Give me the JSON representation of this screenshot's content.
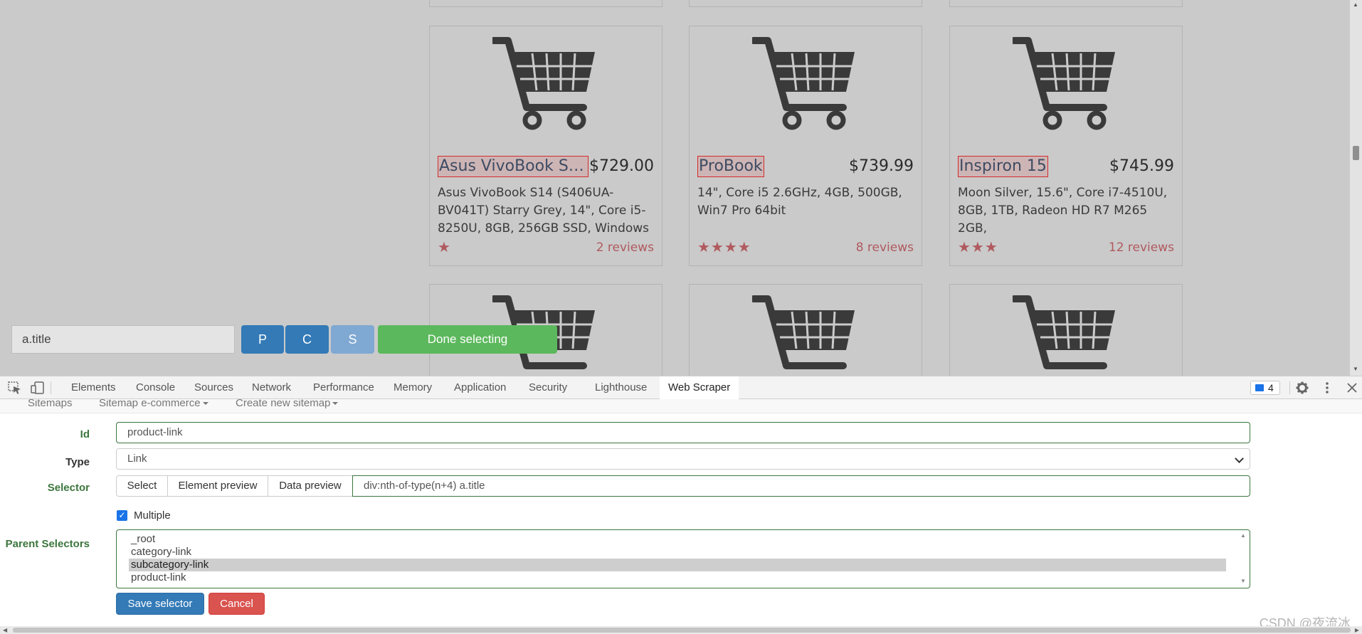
{
  "products": [
    {
      "title": "Asus VivoBook S1...",
      "price": "$729.00",
      "description": "Asus VivoBook S14 (S406UA-BV041T) Starry Grey, 14\", Core i5-8250U, 8GB, 256GB SSD, Windows",
      "stars": "★",
      "reviews": "2 reviews"
    },
    {
      "title": "ProBook",
      "price": "$739.99",
      "description": "14\", Core i5 2.6GHz, 4GB, 500GB, Win7 Pro 64bit",
      "stars": "★★★★",
      "reviews": "8 reviews"
    },
    {
      "title": "Inspiron 15",
      "price": "$745.99",
      "description": "Moon Silver, 15.6\", Core i7-4510U, 8GB, 1TB, Radeon HD R7 M265 2GB,",
      "stars": "★★★",
      "reviews": "12 reviews"
    }
  ],
  "selection_bar": {
    "selector_value": "a.title",
    "parent_button": "P",
    "child_button": "C",
    "select_button": "S",
    "done_button": "Done selecting"
  },
  "devtools": {
    "tabs": [
      "Elements",
      "Console",
      "Sources",
      "Network",
      "Performance",
      "Memory",
      "Application",
      "Security",
      "Lighthouse",
      "Web Scraper"
    ],
    "active_tab": "Web Scraper",
    "issues_count": "4"
  },
  "scraper": {
    "nav": {
      "sitemaps": "Sitemaps",
      "sitemap_menu": "Sitemap e-commerce",
      "create_menu": "Create new sitemap"
    },
    "form": {
      "id_label": "Id",
      "id_value": "product-link",
      "type_label": "Type",
      "type_value": "Link",
      "selector_label": "Selector",
      "select_button": "Select",
      "element_preview_button": "Element preview",
      "data_preview_button": "Data preview",
      "selector_value": "div:nth-of-type(n+4) a.title",
      "multiple_label": "Multiple",
      "multiple_checked": true,
      "parent_selectors_label": "Parent Selectors",
      "parent_selectors": [
        "_root",
        "category-link",
        "subcategory-link",
        "product-link"
      ],
      "parent_selected": "subcategory-link",
      "save_button": "Save selector",
      "cancel_button": "Cancel"
    }
  },
  "watermark": "CSDN @夜流冰",
  "colors": {
    "primary": "#337ab7",
    "success": "#5cb85c",
    "danger": "#d9534f",
    "form_valid": "#3c763d",
    "highlight_border": "#d42b2b",
    "star_color": "#b05a5f"
  }
}
